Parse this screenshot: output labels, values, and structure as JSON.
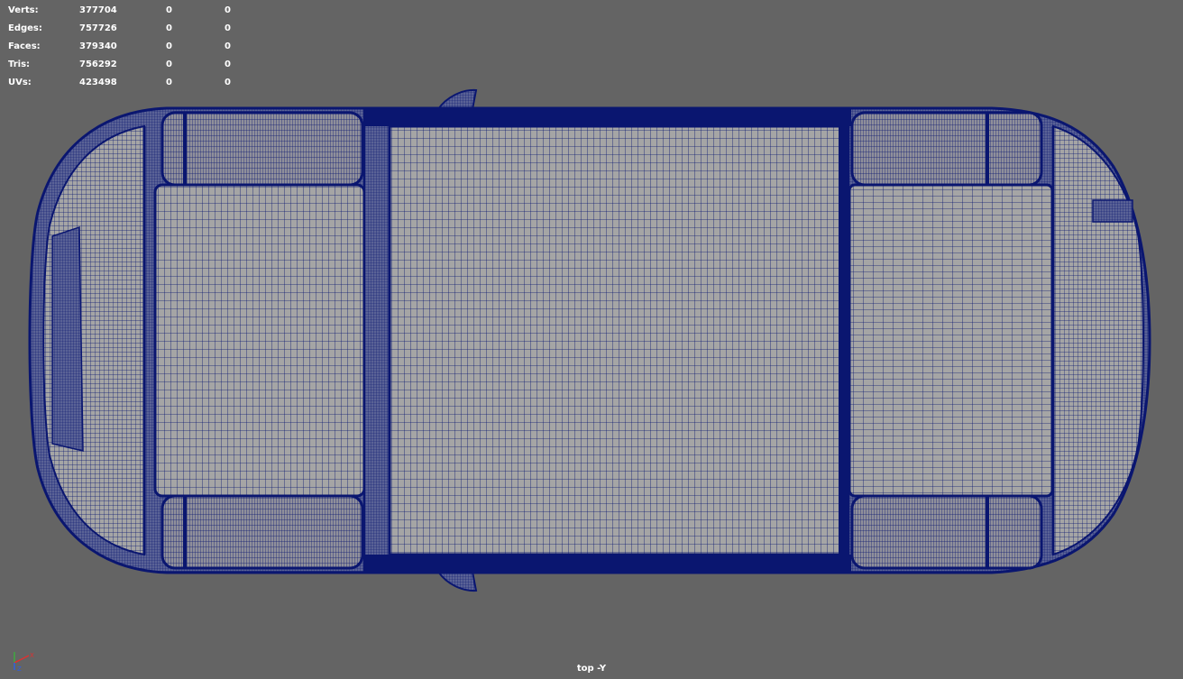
{
  "viewport": {
    "background": "#646464",
    "wire_color": "#0a1670",
    "surface_color": "#a5a5a5",
    "view_label": "top -Y"
  },
  "hud": {
    "rows": [
      {
        "label": "Verts:",
        "total": "377704",
        "selected": "0",
        "component": "0"
      },
      {
        "label": "Edges:",
        "total": "757726",
        "selected": "0",
        "component": "0"
      },
      {
        "label": "Faces:",
        "total": "379340",
        "selected": "0",
        "component": "0"
      },
      {
        "label": "Tris:",
        "total": "756292",
        "selected": "0",
        "component": "0"
      },
      {
        "label": "UVs:",
        "total": "423498",
        "selected": "0",
        "component": "0"
      }
    ]
  },
  "axis": {
    "x_label": "X",
    "z_label": "Z",
    "x_color": "#e03030",
    "z_color": "#3060e0"
  },
  "model": {
    "icon": "car-wireframe-top-view"
  }
}
